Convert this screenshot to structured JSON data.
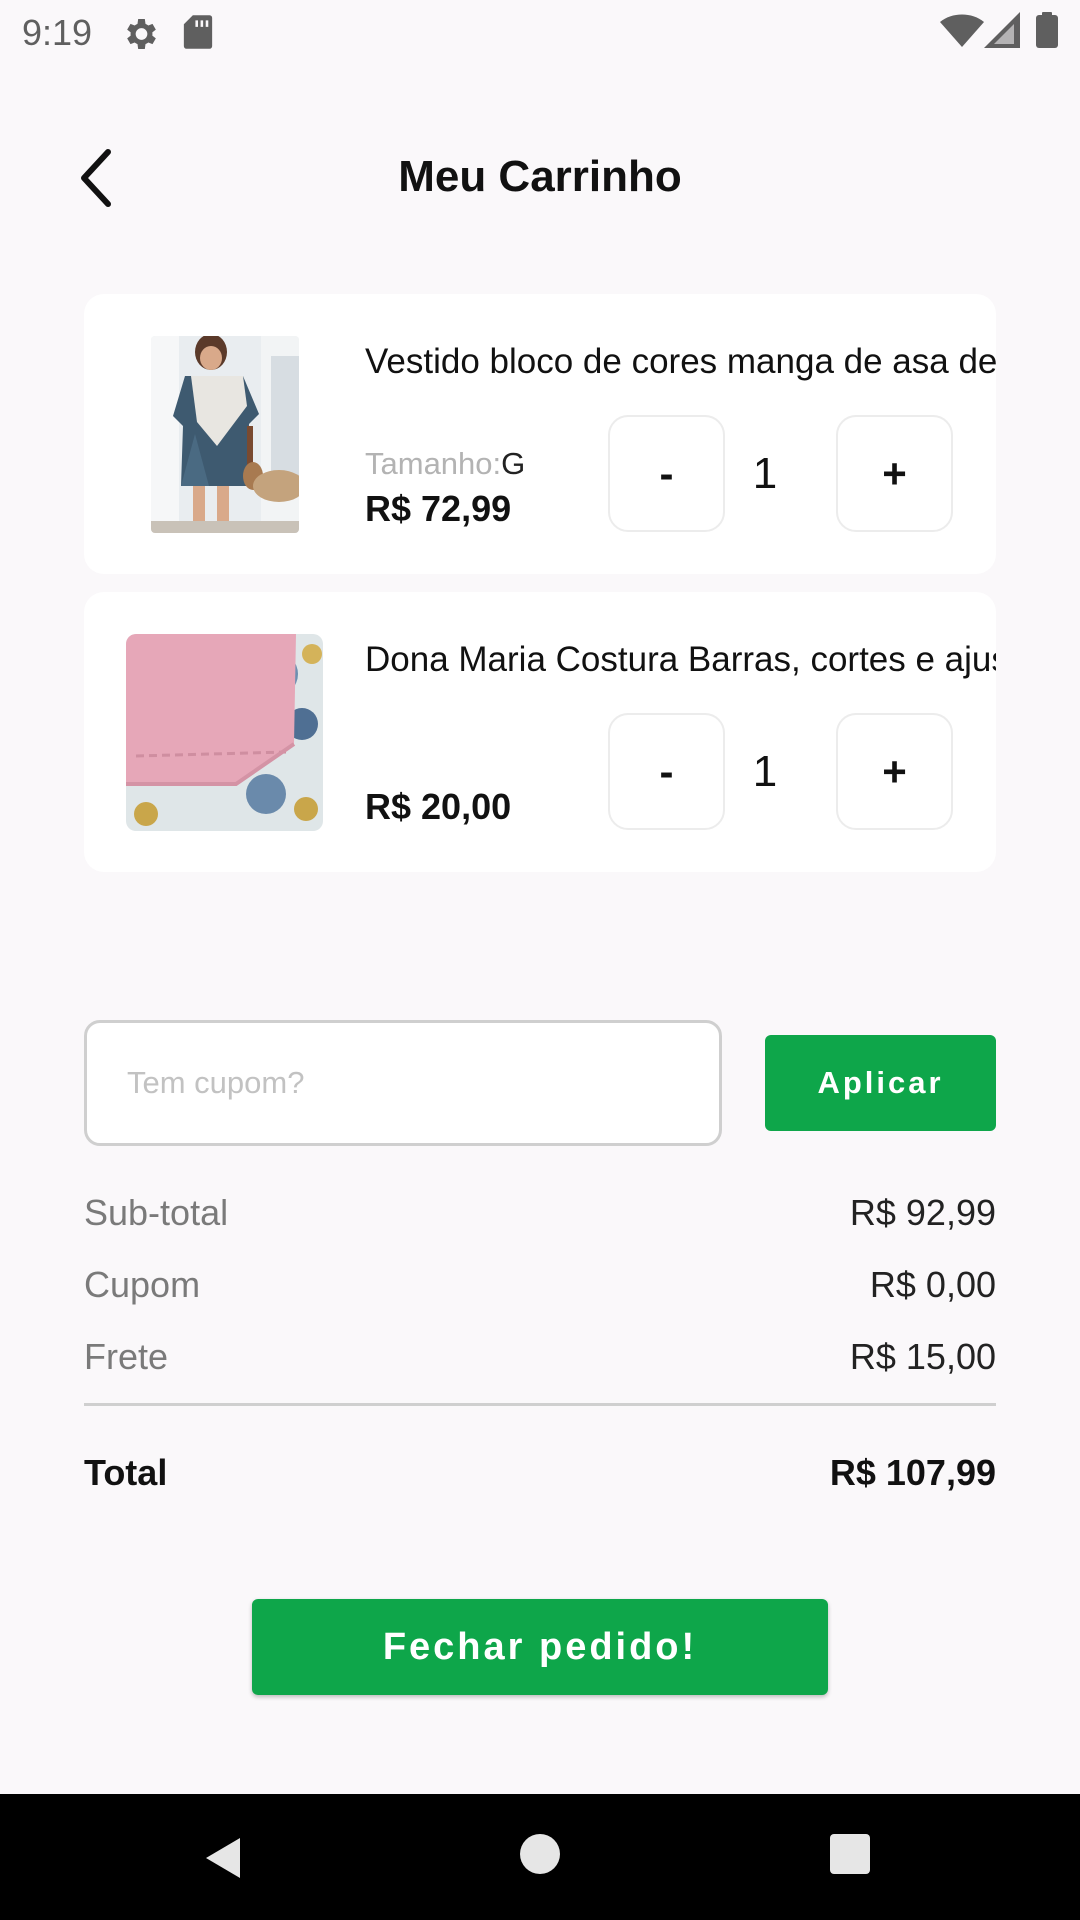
{
  "status_bar": {
    "time": "9:19",
    "icons": [
      "settings-gear-icon",
      "sd-card-icon",
      "wifi-icon",
      "cell-signal-icon",
      "battery-icon"
    ]
  },
  "header": {
    "title": "Meu Carrinho",
    "back_icon": "chevron-left-icon"
  },
  "cart": {
    "items": [
      {
        "name": "Vestido bloco de cores manga de asa de morcego",
        "size_label": "Tamanho:",
        "size_value": "G",
        "price": "R$ 72,99",
        "quantity": "1",
        "minus_label": "-",
        "plus_label": "+",
        "image": "dress-photo"
      },
      {
        "name": "Dona Maria Costura Barras, cortes e ajustes",
        "price": "R$ 20,00",
        "quantity": "1",
        "minus_label": "-",
        "plus_label": "+",
        "image": "fabric-photo"
      }
    ]
  },
  "coupon": {
    "placeholder": "Tem cupom?",
    "value": "",
    "apply_label": "Aplicar"
  },
  "summary": {
    "subtotal_label": "Sub-total",
    "subtotal_value": "R$ 92,99",
    "coupon_label": "Cupom",
    "coupon_value": "R$ 0,00",
    "shipping_label": "Frete",
    "shipping_value": "R$ 15,00",
    "total_label": "Total",
    "total_value": "R$ 107,99"
  },
  "checkout": {
    "label": "Fechar pedido!"
  },
  "nav_bar": {
    "icons": [
      "nav-back-icon",
      "nav-home-icon",
      "nav-recents-icon"
    ]
  },
  "colors": {
    "accent": "#0ea64a",
    "background": "#faf8fa",
    "card": "#ffffff"
  }
}
